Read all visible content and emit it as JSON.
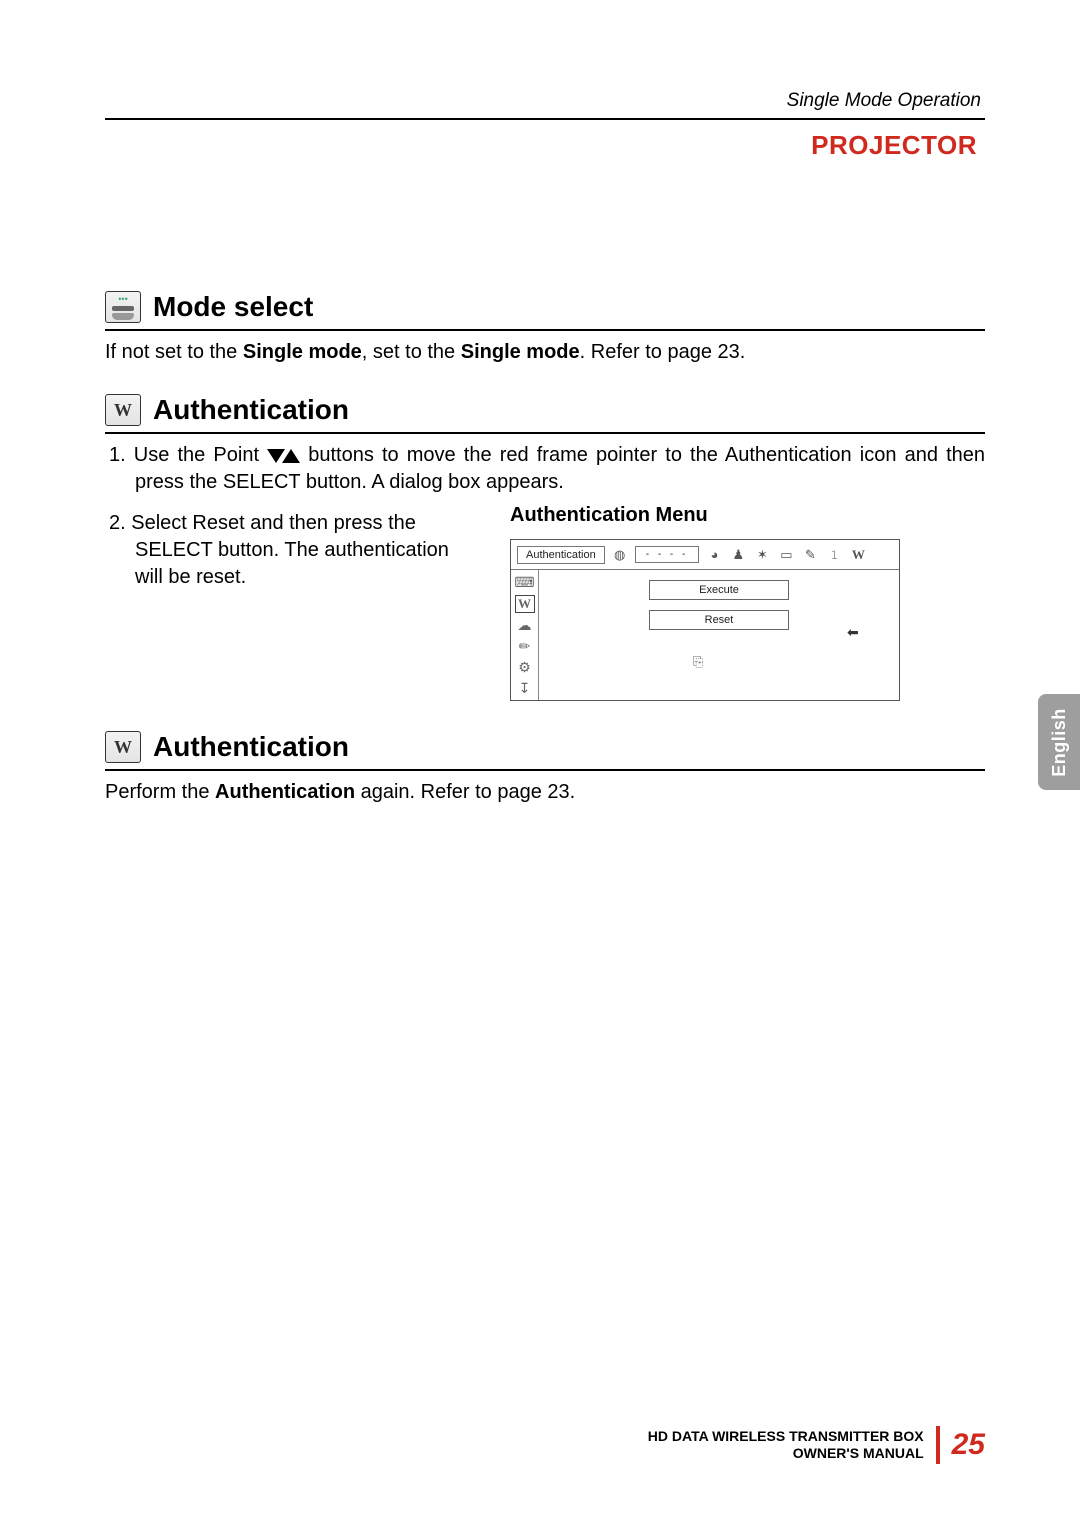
{
  "header": {
    "section_label": "Single Mode Operation",
    "projector": "PROJECTOR"
  },
  "mode_select": {
    "heading": "Mode select",
    "text_pre": "If not set to the ",
    "text_b1": "Single mode",
    "text_mid": ", set to the ",
    "text_b2": "Single mode",
    "text_post": ". Refer to page 23."
  },
  "auth1": {
    "heading": "Authentication",
    "step1_pre": "1.  Use the Point ",
    "step1_mid": " buttons to move the red frame pointer to the ",
    "step1_b": "Authentication",
    "step1_post": " icon and then press the SELECT button. A dialog box appears.",
    "step2_pre": "2. Select ",
    "step2_b": "Reset",
    "step2_post": " and then press the SELECT button. The authentication will be reset.",
    "menu_title": "Authentication Menu",
    "menu_label": "Authentication",
    "menu_dashes": "- - - -",
    "menu_execute": "Execute",
    "menu_reset": "Reset"
  },
  "auth2": {
    "heading": "Authentication",
    "text_pre": "Perform the ",
    "text_b": "Authentication",
    "text_post": " again. Refer to page 23."
  },
  "lang_tab": "English",
  "footer": {
    "line1": "HD DATA WIRELESS TRANSMITTER BOX",
    "line2": "OWNER'S MANUAL",
    "page": "25"
  }
}
